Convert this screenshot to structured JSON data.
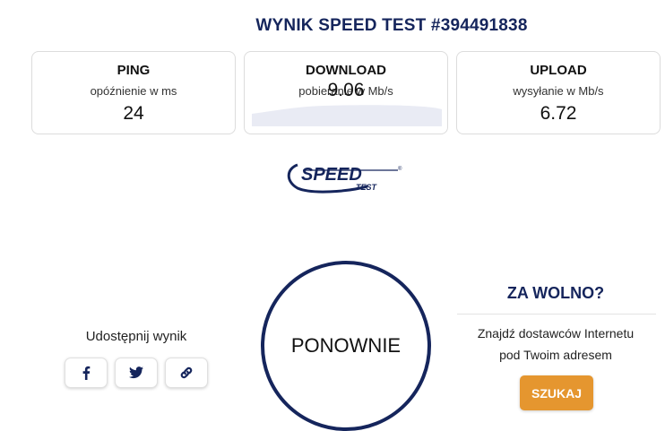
{
  "result": {
    "title": "WYNIK SPEED TEST #394491838"
  },
  "metrics": {
    "ping": {
      "label": "PING",
      "sub": "opóźnienie w ms",
      "value": "24"
    },
    "download": {
      "label": "DOWNLOAD",
      "sub": "pobieranie w Mb/s",
      "value": "9.06"
    },
    "upload": {
      "label": "UPLOAD",
      "sub": "wysyłanie w Mb/s",
      "value": "6.72"
    }
  },
  "logo": {
    "line1": "SPEED",
    "line2": "TEST",
    "mark": "®"
  },
  "share": {
    "label": "Udostępnij wynik",
    "buttons": [
      {
        "icon": "facebook-icon"
      },
      {
        "icon": "twitter-icon"
      },
      {
        "icon": "link-icon"
      }
    ]
  },
  "retest": {
    "label": "PONOWNIE"
  },
  "slow": {
    "title": "ZA WOLNO?",
    "text_line1": "Znajdź dostawców Internetu",
    "text_line2": "pod Twoim adresem",
    "button": "SZUKAJ"
  },
  "colors": {
    "brand": "#15255c",
    "accent": "#e5962f",
    "wave": "#e9ebf4"
  }
}
